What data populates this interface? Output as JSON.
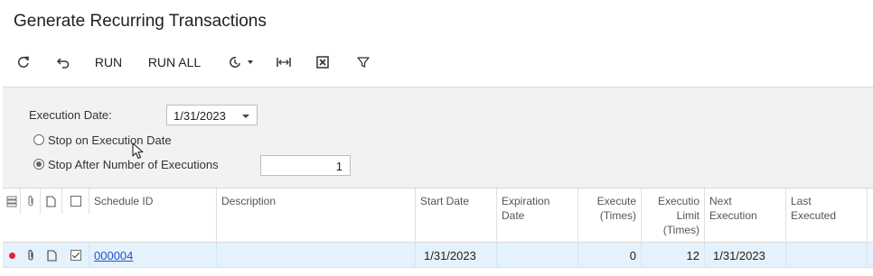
{
  "page": {
    "title": "Generate Recurring Transactions"
  },
  "toolbar": {
    "refresh_icon": "refresh-icon",
    "undo_icon": "undo-icon",
    "run_label": "RUN",
    "run_all_label": "RUN ALL",
    "schedule_icon": "schedule-icon",
    "fit_icon": "fit-to-screen-icon",
    "excel_icon": "export-excel-icon",
    "filter_icon": "filter-icon"
  },
  "filters": {
    "execution_date_label": "Execution Date:",
    "execution_date_value": "1/31/2023",
    "stop_on_date_label": "Stop on Execution Date",
    "stop_after_label": "Stop After Number of Executions",
    "stop_after_value": "1",
    "selected_option": "stop_after"
  },
  "grid": {
    "columns": {
      "schedule_id": "Schedule ID",
      "description": "Description",
      "start_date": "Start Date",
      "expiration_date": [
        "Expiration",
        "Date"
      ],
      "executed_times": [
        "Execute",
        "(Times)"
      ],
      "execution_limit": [
        "Executio",
        "Limit",
        "(Times)"
      ],
      "next_execution": [
        "Next",
        "Execution"
      ],
      "last_executed": [
        "Last",
        "Executed"
      ]
    },
    "rows": [
      {
        "status_color": "#e0202f",
        "selected": true,
        "schedule_id": "000004",
        "description": "",
        "start_date": "1/31/2023",
        "expiration_date": "",
        "executed_times": "0",
        "execution_limit": "12",
        "next_execution": "1/31/2023",
        "last_executed": ""
      }
    ]
  }
}
